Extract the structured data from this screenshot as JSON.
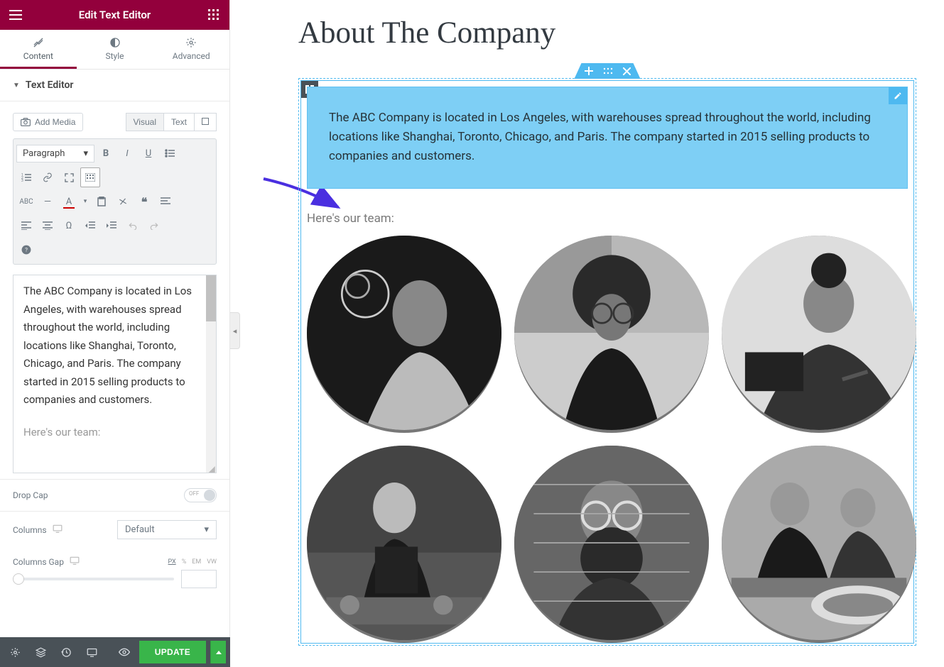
{
  "header": {
    "title": "Edit Text Editor"
  },
  "tabs": {
    "content": "Content",
    "style": "Style",
    "advanced": "Advanced"
  },
  "section": {
    "title": "Text Editor"
  },
  "editor": {
    "add_media": "Add Media",
    "visual": "Visual",
    "text": "Text",
    "format": "Paragraph",
    "content_p1": "The ABC Company is located in Los Angeles, with warehouses spread throughout the world, including locations like Shanghai, Toronto, Chicago, and Paris. The company started in 2015 selling products to companies and customers.",
    "content_p2": "Here's our team:"
  },
  "controls": {
    "dropcap_label": "Drop Cap",
    "dropcap_state": "OFF",
    "columns_label": "Columns",
    "columns_value": "Default",
    "gap_label": "Columns Gap",
    "units": [
      "PX",
      "%",
      "EM",
      "VW"
    ]
  },
  "footer": {
    "update": "UPDATE"
  },
  "preview": {
    "page_title": "About The Company",
    "body": "The ABC Company is located in Los Angeles, with warehouses spread throughout the world, including locations like Shanghai, Toronto, Chicago, and Paris. The company started in 2015 selling products to companies and customers.",
    "team_label": "Here's our team:"
  }
}
